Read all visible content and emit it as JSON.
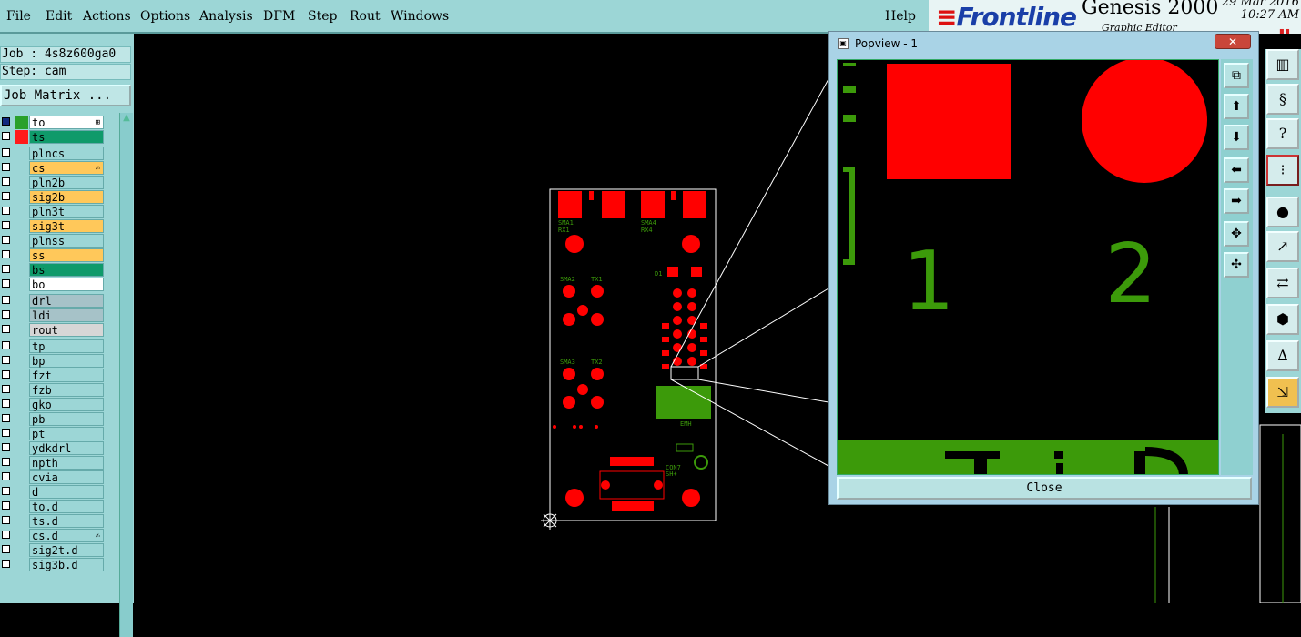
{
  "menu": {
    "items": [
      "File",
      "Edit",
      "Actions",
      "Options",
      "Analysis",
      "DFM",
      "Step",
      "Rout",
      "Windows"
    ],
    "help": "Help"
  },
  "brand": {
    "logo": "Frontline",
    "title": "Genesis 2000",
    "subtitle": "Graphic Editor",
    "date": "29 Mar 2016",
    "time": "10:27 AM"
  },
  "info": {
    "job": "Job : 4s8z600ga0",
    "step": "Step: cam",
    "matrix_button": "Job Matrix ..."
  },
  "layers": [
    {
      "name": "to",
      "bg": "#ffffff",
      "swatch": "#2aa02a",
      "checked": true,
      "flag": "⊞"
    },
    {
      "name": "ts",
      "bg": "#0f9a6a",
      "swatch": "#ff1a1a",
      "checked": false,
      "flag": ""
    },
    {
      "name": "plncs",
      "bg": "#9cd6d6",
      "swatch": "",
      "checked": false,
      "flag": ""
    },
    {
      "name": "cs",
      "bg": "#ffc85a",
      "swatch": "",
      "checked": false,
      "flag": "✍"
    },
    {
      "name": "pln2b",
      "bg": "#9cd6d6",
      "swatch": "",
      "checked": false,
      "flag": ""
    },
    {
      "name": "sig2b",
      "bg": "#ffc85a",
      "swatch": "",
      "checked": false,
      "flag": ""
    },
    {
      "name": "pln3t",
      "bg": "#9cd6d6",
      "swatch": "",
      "checked": false,
      "flag": ""
    },
    {
      "name": "sig3t",
      "bg": "#ffc85a",
      "swatch": "",
      "checked": false,
      "flag": ""
    },
    {
      "name": "plnss",
      "bg": "#9cd6d6",
      "swatch": "",
      "checked": false,
      "flag": ""
    },
    {
      "name": "ss",
      "bg": "#ffc85a",
      "swatch": "",
      "checked": false,
      "flag": ""
    },
    {
      "name": "bs",
      "bg": "#0f9a6a",
      "swatch": "",
      "checked": false,
      "flag": ""
    },
    {
      "name": "bo",
      "bg": "#ffffff",
      "swatch": "",
      "checked": false,
      "flag": ""
    },
    {
      "name": "drl",
      "bg": "#a6c2c8",
      "swatch": "",
      "checked": false,
      "flag": ""
    },
    {
      "name": "ldi",
      "bg": "#a6c2c8",
      "swatch": "",
      "checked": false,
      "flag": ""
    },
    {
      "name": "rout",
      "bg": "#d6d6d6",
      "swatch": "",
      "checked": false,
      "flag": ""
    },
    {
      "name": "tp",
      "bg": "#9cd6d6",
      "swatch": "",
      "checked": false,
      "flag": ""
    },
    {
      "name": "bp",
      "bg": "#9cd6d6",
      "swatch": "",
      "checked": false,
      "flag": ""
    },
    {
      "name": "fzt",
      "bg": "#9cd6d6",
      "swatch": "",
      "checked": false,
      "flag": ""
    },
    {
      "name": "fzb",
      "bg": "#9cd6d6",
      "swatch": "",
      "checked": false,
      "flag": ""
    },
    {
      "name": "gko",
      "bg": "#9cd6d6",
      "swatch": "",
      "checked": false,
      "flag": ""
    },
    {
      "name": "pb",
      "bg": "#9cd6d6",
      "swatch": "",
      "checked": false,
      "flag": ""
    },
    {
      "name": "pt",
      "bg": "#9cd6d6",
      "swatch": "",
      "checked": false,
      "flag": ""
    },
    {
      "name": "ydkdrl",
      "bg": "#9cd6d6",
      "swatch": "",
      "checked": false,
      "flag": ""
    },
    {
      "name": "npth",
      "bg": "#9cd6d6",
      "swatch": "",
      "checked": false,
      "flag": ""
    },
    {
      "name": "cvia",
      "bg": "#9cd6d6",
      "swatch": "",
      "checked": false,
      "flag": ""
    },
    {
      "name": "d",
      "bg": "#9cd6d6",
      "swatch": "",
      "checked": false,
      "flag": ""
    },
    {
      "name": "to.d",
      "bg": "#9cd6d6",
      "swatch": "",
      "checked": false,
      "flag": ""
    },
    {
      "name": "ts.d",
      "bg": "#9cd6d6",
      "swatch": "",
      "checked": false,
      "flag": ""
    },
    {
      "name": "cs.d",
      "bg": "#9cd6d6",
      "swatch": "",
      "checked": false,
      "flag": "✍"
    },
    {
      "name": "sig2t.d",
      "bg": "#9cd6d6",
      "swatch": "",
      "checked": false,
      "flag": ""
    },
    {
      "name": "sig3b.d",
      "bg": "#9cd6d6",
      "swatch": "",
      "checked": false,
      "flag": ""
    }
  ],
  "board_labels": {
    "sma1": "SMA1",
    "rx1": "RX1",
    "sma4": "SMA4",
    "rx4": "RX4",
    "sma2": "SMA2",
    "tx1": "TX1",
    "sma3": "SMA3",
    "tx2": "TX2",
    "d1": "D1",
    "con7": "CON7",
    "sh": "SH+",
    "emh": "EMH"
  },
  "popup": {
    "title": "Popview - 1",
    "close_x": "✕",
    "close_button": "Close",
    "pad1_label": "1",
    "pad2_label": "2"
  },
  "colors": {
    "panel": "#9cd6d6",
    "pad_red": "#ff0000",
    "silk_green": "#3c9a0a"
  }
}
